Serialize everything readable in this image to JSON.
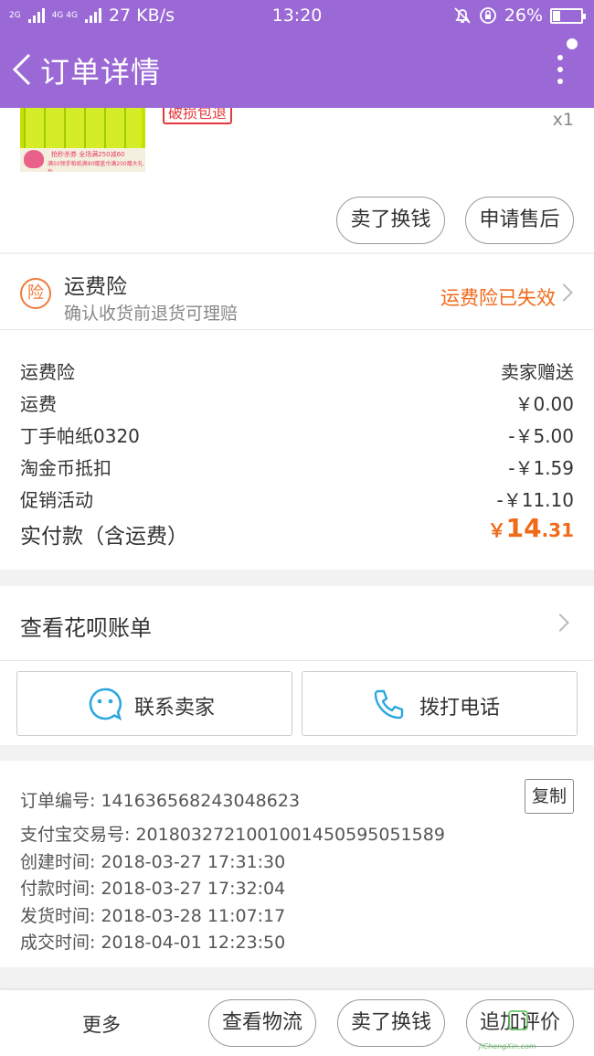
{
  "status_bar": {
    "network_left": "2G",
    "network_4g": "4G 4G",
    "speed": "27 KB/s",
    "time": "13:20",
    "battery": "26%",
    "battery_level": 0.26
  },
  "header": {
    "title": "订单详情"
  },
  "product": {
    "image_promo_line1": "抢秒杀券 全场满250减60",
    "image_promo_line2": "满50领手帕纸满90赠蓝巾满200赠大礼包",
    "tag": "破损包退",
    "quantity": "x1",
    "actions": [
      "卖了换钱",
      "申请售后"
    ]
  },
  "insurance": {
    "icon_text": "险",
    "title": "运费险",
    "subtitle": "确认收货前退货可理赔",
    "status": "运费险已失效"
  },
  "fees": [
    {
      "label": "运费险",
      "value": "卖家赠送"
    },
    {
      "label": "运费",
      "value": "￥0.00"
    },
    {
      "label": "丁手帕纸0320",
      "value": "-￥5.00"
    },
    {
      "label": "淘金币抵扣",
      "value": "-￥1.59"
    },
    {
      "label": "促销活动",
      "value": "-￥11.10"
    }
  ],
  "total": {
    "label": "实付款（含运费）",
    "currency": "￥",
    "integer": "14",
    "decimal": ".31"
  },
  "huabei": {
    "label": "查看花呗账单"
  },
  "contact": {
    "seller": "联系卖家",
    "phone": "拨打电话"
  },
  "order_info": {
    "order_no": "订单编号: 141636568243048623",
    "alipay_no": "支付宝交易号: 2018032721001001450595051589",
    "created": "创建时间: 2018-03-27 17:31:30",
    "paid": "付款时间: 2018-03-27 17:32:04",
    "shipped": "发货时间: 2018-03-28 11:07:17",
    "completed": "成交时间: 2018-04-01 12:23:50",
    "copy_label": "复制"
  },
  "bottom_bar": {
    "more": "更多",
    "logistics": "查看物流",
    "sell": "卖了换钱",
    "review": "追加评价"
  },
  "watermark": "JiChengXin.com",
  "colors": {
    "accent": "#9b69d6",
    "orange": "#f06a1a",
    "red": "#e4393c"
  }
}
